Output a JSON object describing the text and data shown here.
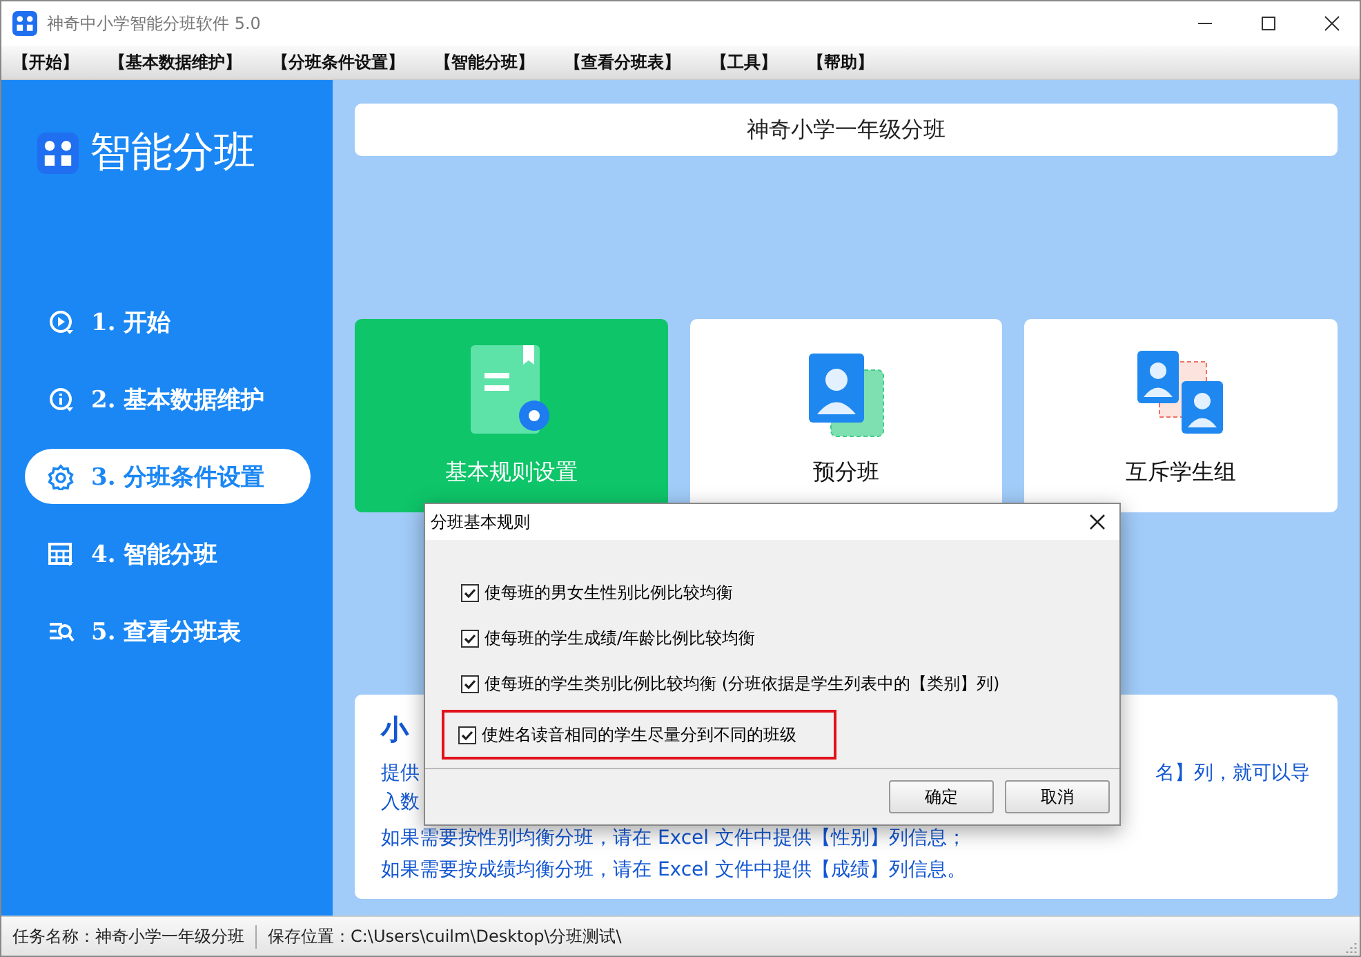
{
  "window": {
    "title": "神奇中小学智能分班软件 5.0"
  },
  "menu": [
    "【开始】",
    "【基本数据维护】",
    "【分班条件设置】",
    "【智能分班】",
    "【查看分班表】",
    "【工具】",
    "【帮助】"
  ],
  "sidebar": {
    "logo_text": "智能分班",
    "items": [
      {
        "label": "1. 开始",
        "selected": false
      },
      {
        "label": "2. 基本数据维护",
        "selected": false
      },
      {
        "label": "3. 分班条件设置",
        "selected": true
      },
      {
        "label": "4. 智能分班",
        "selected": false
      },
      {
        "label": "5. 查看分班表",
        "selected": false
      }
    ]
  },
  "header": "神奇小学一年级分班",
  "cards": [
    {
      "label": "基本规则设置",
      "kind": "rules",
      "selected": true
    },
    {
      "label": "预分班",
      "kind": "profile",
      "selected": false
    },
    {
      "label": "互斥学生组",
      "kind": "pair",
      "selected": false
    }
  ],
  "tip_card": {
    "title": "小",
    "lines": [
      {
        "left": "提供",
        "right": "名】列，就可以导"
      },
      {
        "left": "入数"
      },
      {
        "left": "如果需要按性别均衡分班，请在 Excel 文件中提供【性别】列信息；"
      },
      {
        "left": "如果需要按成绩均衡分班，请在 Excel 文件中提供【成绩】列信息。"
      }
    ]
  },
  "dialog": {
    "title": "分班基本规则",
    "options": [
      {
        "label": "使每班的男女生性别比例比较均衡",
        "checked": true,
        "highlighted": false
      },
      {
        "label": "使每班的学生成绩/年龄比例比较均衡",
        "checked": true,
        "highlighted": false
      },
      {
        "label": "使每班的学生类别比例比较均衡 (分班依据是学生列表中的【类别】列)",
        "checked": true,
        "highlighted": false
      },
      {
        "label": "使姓名读音相同的学生尽量分到不同的班级",
        "checked": true,
        "highlighted": true
      }
    ],
    "buttons": [
      "确定",
      "取消"
    ]
  },
  "status_bar": {
    "task": "任务名称：神奇小学一年级分班",
    "path": "保存位置：C:\\Users\\cuilm\\Desktop\\分班测试\\"
  }
}
